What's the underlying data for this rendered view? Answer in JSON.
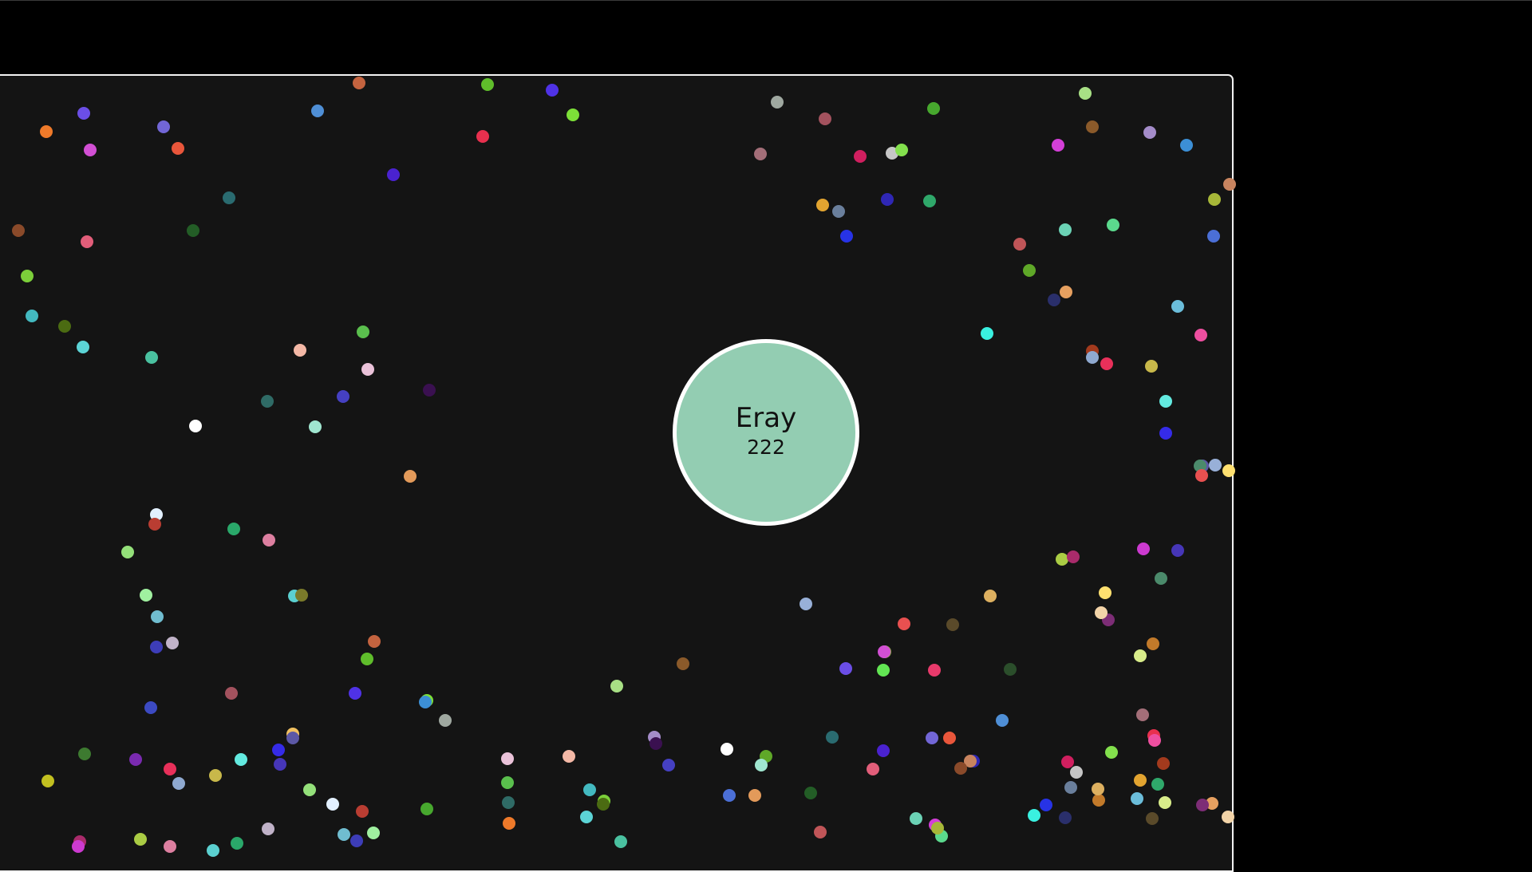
{
  "player": {
    "name": "Eray",
    "mass": "222",
    "color": "#93cdb2",
    "border_color": "#ffffff"
  },
  "colors": {
    "page_background": "#000000",
    "arena_background": "#141414",
    "arena_border": "#f2f2f2"
  },
  "pellet_colors": [
    "#c4633f",
    "#5fbd2b",
    "#4f32e6",
    "#7de038",
    "#9fa8a0",
    "#a3525e",
    "#47a82e",
    "#a8e085",
    "#8b5a2a",
    "#a48cc9",
    "#3c8fd6",
    "#ef7a2a",
    "#6b4ee6",
    "#d24fd4",
    "#7266d6",
    "#e9563b",
    "#4f8fd6",
    "#e8304e",
    "#a36e78",
    "#d01f5f",
    "#c6c6c6",
    "#83e04d",
    "#2fa86a",
    "#e2a430",
    "#6a7f9c",
    "#2733e6",
    "#2f27b5",
    "#d43fd8",
    "#5bd98d",
    "#a7b738",
    "#c8845f",
    "#8a4a2a",
    "#e25e7a",
    "#2a6b70",
    "#235d26",
    "#4a22d0",
    "#6bd2b5",
    "#c05558",
    "#5fa828",
    "#4b6fd6",
    "#7ccf3a",
    "#43b9c0",
    "#4b6b12",
    "#5cd4d6",
    "#4ac1a0",
    "#f4b8a6",
    "#5abf4d",
    "#eac2d9",
    "#2f6b66",
    "#4540c2",
    "#3a1050",
    "#ffffff",
    "#a0e6d0",
    "#e39a5a",
    "#3af0e0",
    "#2a2f6b",
    "#e6a060",
    "#6bbdda",
    "#ee4fa0",
    "#a33a1d",
    "#e8305a",
    "#8fa9d0",
    "#c8b84a",
    "#63eae0",
    "#352be8",
    "#5c58a6",
    "#4636b8",
    "#e2f0ff",
    "#b93d32",
    "#94e07a",
    "#a0f0a0",
    "#70bdd0",
    "#3d3db8",
    "#c0b2c8",
    "#2aa86a",
    "#dd7fa0",
    "#5bd0d0",
    "#aacc44",
    "#a92b6b",
    "#cc3ad0",
    "#4b8a6b",
    "#ffe070",
    "#7d2d76",
    "#f3d4a8",
    "#c27a2a",
    "#d8ec8a",
    "#ddb060",
    "#5a4a2a",
    "#e85050",
    "#98b0d8",
    "#90aa50",
    "#62e653",
    "#e83a6b",
    "#2b4e2b",
    "#3c4ac2",
    "#7a2ab0",
    "#3d7a30",
    "#c2c020",
    "#7a7a2a",
    "#f0c060"
  ]
}
